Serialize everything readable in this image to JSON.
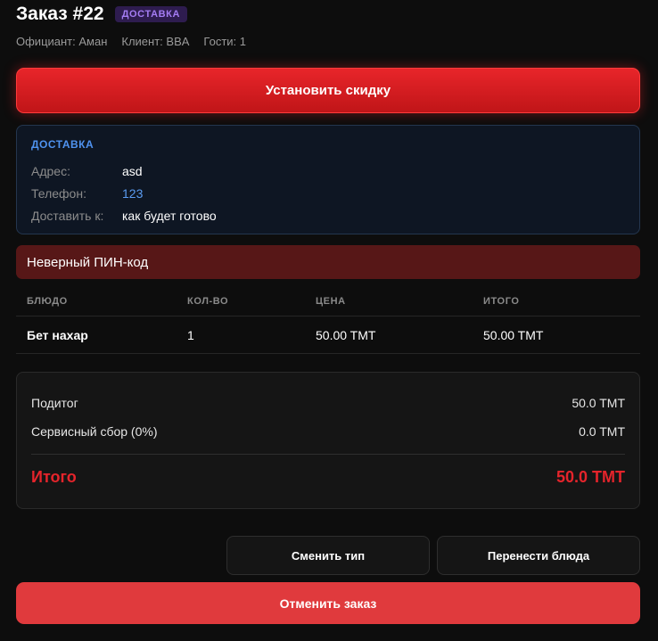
{
  "order": {
    "title": "Заказ #22",
    "type_badge": "ДОСТАВКА",
    "meta": {
      "waiter": "Официант: Аман",
      "client": "Клиент: BBA",
      "guests": "Гости: 1"
    }
  },
  "discount_button": "Установить скидку",
  "delivery": {
    "heading": "ДОСТАВКА",
    "address_label": "Адрес:",
    "address_value": "asd",
    "phone_label": "Телефон:",
    "phone_value": "123",
    "deliver_at_label": "Доставить к:",
    "deliver_at_value": "как будет готово"
  },
  "error_message": "Неверный ПИН-код",
  "items_table": {
    "headers": [
      "БЛЮДО",
      "КОЛ-ВО",
      "ЦЕНА",
      "ИТОГО"
    ],
    "rows": [
      {
        "dish": "Бет нахар",
        "qty": "1",
        "price": "50.00 TMT",
        "total": "50.00 TMT"
      }
    ]
  },
  "totals": {
    "subtotal_label": "Подитог",
    "subtotal_value": "50.0 TMT",
    "service_label": "Сервисный сбор (0%)",
    "service_value": "0.0 TMT",
    "grand_label": "Итого",
    "grand_value": "50.0 TMT"
  },
  "actions": {
    "change_type": "Сменить тип",
    "move_dishes": "Перенести блюда",
    "cancel_order": "Отменить заказ"
  },
  "colors": {
    "accent_red": "#e5242b",
    "badge_purple": "#a47cf3",
    "link_blue": "#5b9cf2",
    "error_bg": "#571717"
  }
}
